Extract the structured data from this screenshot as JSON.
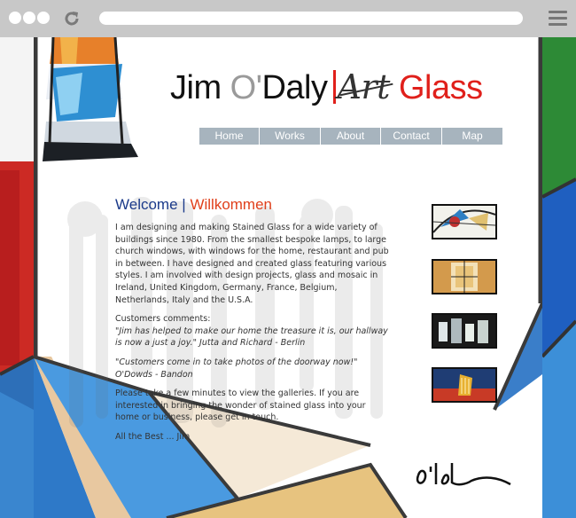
{
  "browser": {
    "reload_icon": "reload-icon",
    "menu_icon": "hamburger-menu-icon"
  },
  "site": {
    "title_part1": "Jim",
    "title_part2": "O'",
    "title_part3": "Daly",
    "title_part4": "Art",
    "title_part5": "Glass"
  },
  "nav": {
    "items": [
      "Home",
      "Works",
      "About",
      "Contact",
      "Map"
    ]
  },
  "content": {
    "heading_left": "Welcome",
    "heading_sep": "|",
    "heading_right": "Willkommen",
    "intro": "I am designing and making Stained Glass for a wide variety of buildings since 1980. From the smallest bespoke lamps, to large church windows, with windows for the home, restaurant and pub in between. I have designed and created glass featuring various styles. I am involved with design projects, glass and mosaic in Ireland, United Kingdom, Germany, France, Belgium, Netherlands, Italy and the U.S.A.",
    "comments_label": "Customers comments:",
    "quote1": "\"Jim has helped to make our home the treasure it is, our hallway is now a just a joy.\" Jutta and Richard - Berlin",
    "quote2": "\"Customers come in to take photos of the doorway now!\" O'Dowds - Bandon",
    "invite": "Please take a few minutes to view the galleries. If you are interested in bringing the wonder of stained glass into your home or business, please get in touch.",
    "signoff": "All the Best ... Jim"
  },
  "colors": {
    "accent_red": "#e0201b",
    "heading_blue": "#1b3a8a",
    "nav_bg": "#a7b4be",
    "browser_chrome": "#c8c8c8"
  }
}
